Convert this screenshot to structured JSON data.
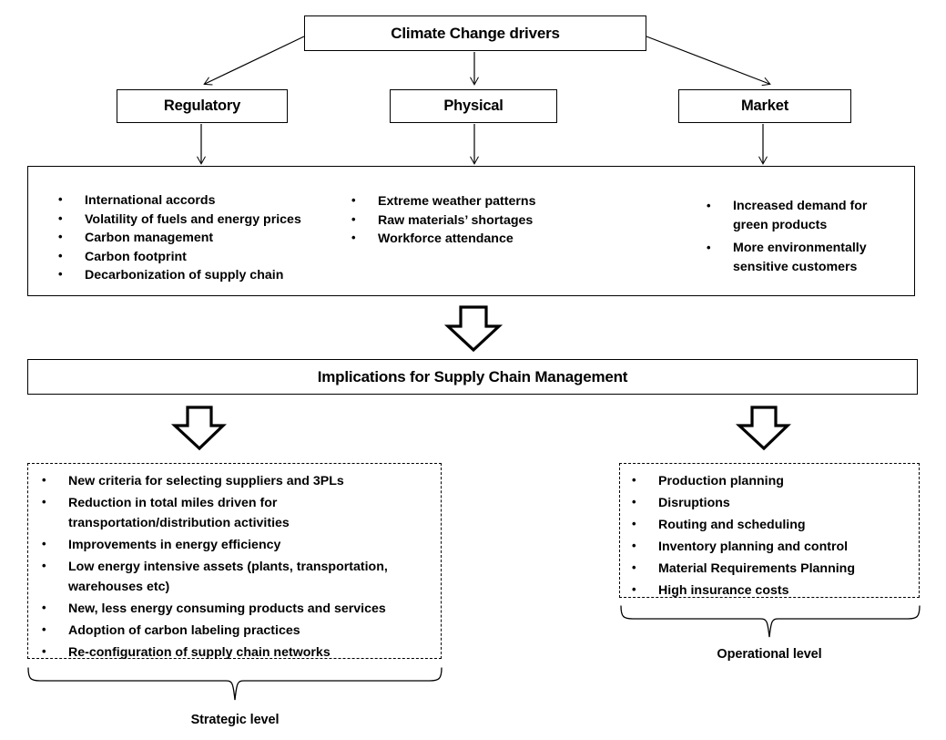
{
  "diagram": {
    "title_box": {
      "label": "Climate Change drivers"
    },
    "categories": [
      {
        "label": "Regulatory"
      },
      {
        "label": "Physical"
      },
      {
        "label": "Market"
      }
    ],
    "drivers_columns": [
      {
        "name": "regulatory-drivers",
        "items": [
          "International accords",
          "Volatility  of fuels and energy prices",
          "Carbon management",
          "Carbon footprint",
          "Decarbonization of supply chain"
        ]
      },
      {
        "name": "physical-drivers",
        "items": [
          "Extreme weather patterns",
          "Raw materials’ shortages",
          "Workforce attendance"
        ]
      },
      {
        "name": "market-drivers",
        "items": [
          "Increased demand for green products",
          "More environmentally sensitive customers"
        ]
      }
    ],
    "implications_bar": {
      "label": "Implications for Supply Chain Management"
    },
    "strategic": {
      "items": [
        "New criteria  for selecting suppliers and 3PLs",
        "Reduction in total miles driven for transportation/distribution  activities",
        "Improvements in energy efficiency",
        "Low energy intensive assets (plants, transportation, warehouses etc)",
        "New, less energy consuming products and services",
        "Adoption of carbon labeling practices",
        "Re-configuration of supply chain networks"
      ],
      "brace_label": "Strategic level"
    },
    "operational": {
      "items": [
        "Production planning",
        "Disruptions",
        "Routing and scheduling",
        "Inventory planning and control",
        "Material Requirements  Planning",
        "High insurance costs"
      ],
      "brace_label": "Operational level"
    },
    "colors": {
      "stroke": "#000000",
      "background": "#ffffff",
      "text": "#000000"
    }
  }
}
